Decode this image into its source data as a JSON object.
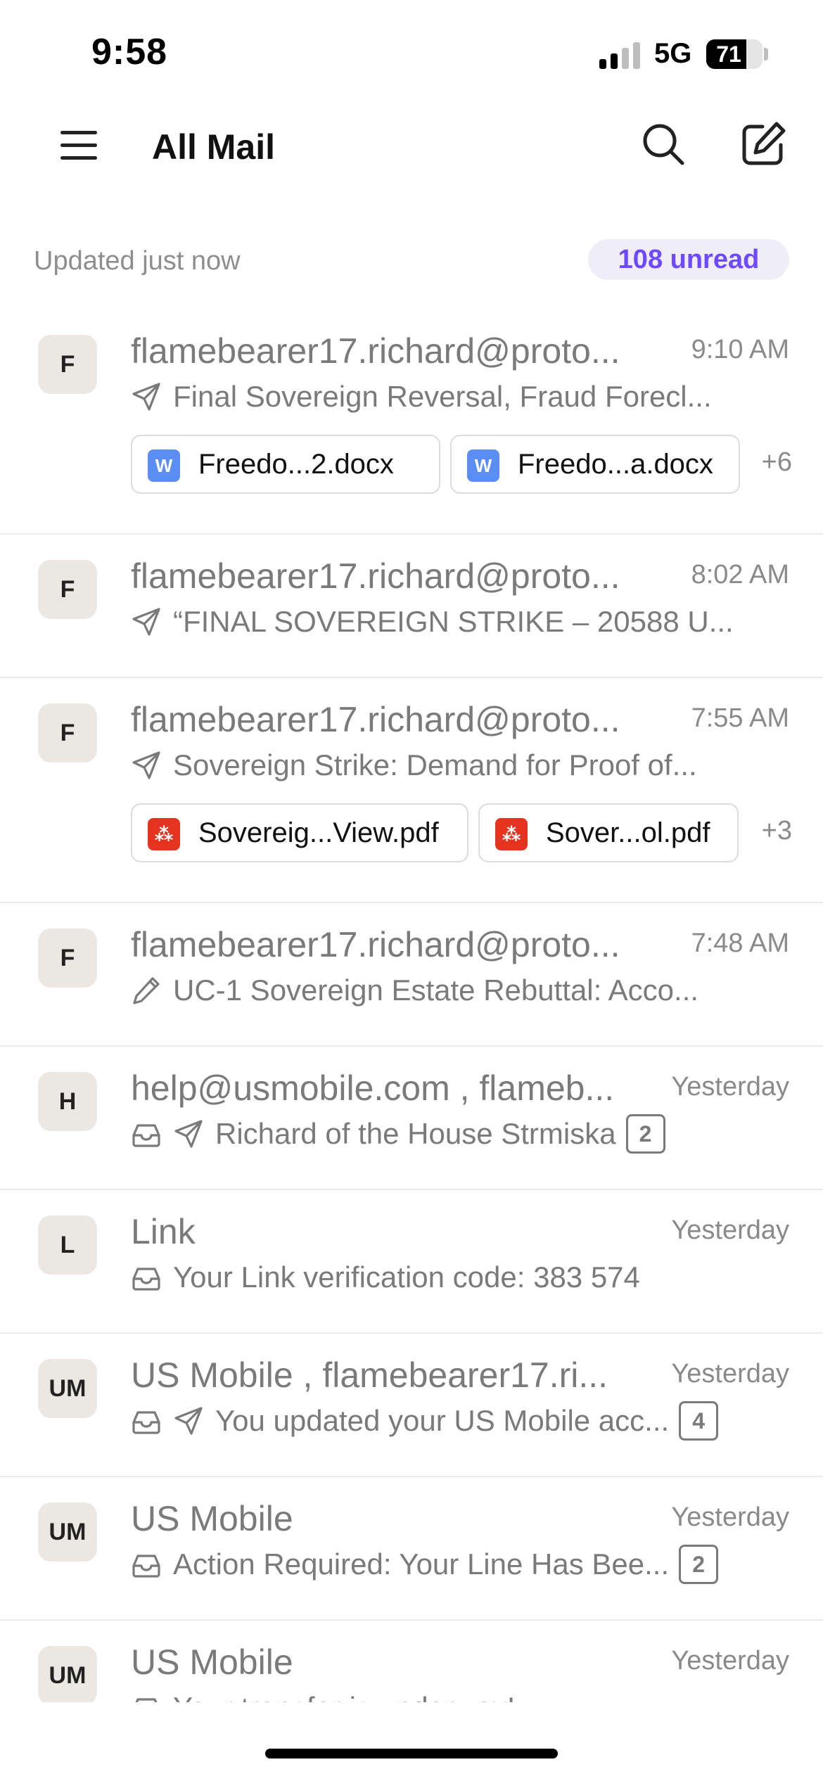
{
  "status_bar": {
    "time": "9:58",
    "network": "5G",
    "battery_level": "71",
    "battery_percent": 71
  },
  "header": {
    "title": "All Mail",
    "menu_icon": "hamburger-menu-icon",
    "search_icon": "search-icon",
    "compose_icon": "compose-icon"
  },
  "sync": {
    "updated_text": "Updated just now",
    "unread_text": "108 unread"
  },
  "colors": {
    "accent": "#6d4aff",
    "word_icon": "#5b8ef5",
    "pdf_icon": "#e63320"
  },
  "messages": [
    {
      "initials": "F",
      "sender": "flamebearer17.richard@proto...",
      "time": "9:10 AM",
      "icons": [
        "sent-icon"
      ],
      "subject": "Final Sovereign Reversal, Fraud Forecl...",
      "count": null,
      "attachments": [
        {
          "type": "word",
          "letter": "W",
          "name": "Freedo...2.docx"
        },
        {
          "type": "word",
          "letter": "W",
          "name": "Freedo...a.docx"
        }
      ],
      "more_attachments": "+6"
    },
    {
      "initials": "F",
      "sender": "flamebearer17.richard@proto...",
      "time": "8:02 AM",
      "icons": [
        "sent-icon"
      ],
      "subject": "“FINAL SOVEREIGN STRIKE – 20588 U...",
      "count": null,
      "attachments": [],
      "more_attachments": null
    },
    {
      "initials": "F",
      "sender": "flamebearer17.richard@proto...",
      "time": "7:55 AM",
      "icons": [
        "sent-icon"
      ],
      "subject": "Sovereign Strike: Demand for Proof of...",
      "count": null,
      "attachments": [
        {
          "type": "pdf",
          "letter": "⁂",
          "name": "Sovereig...View.pdf"
        },
        {
          "type": "pdf",
          "letter": "⁂",
          "name": "Sover...ol.pdf"
        }
      ],
      "more_attachments": "+3"
    },
    {
      "initials": "F",
      "sender": "flamebearer17.richard@proto...",
      "time": "7:48 AM",
      "icons": [
        "draft-pencil-icon"
      ],
      "subject": "UC-1 Sovereign Estate Rebuttal: Acco...",
      "count": null,
      "attachments": [],
      "more_attachments": null
    },
    {
      "initials": "H",
      "sender": "help@usmobile.com , flameb...",
      "time": "Yesterday",
      "icons": [
        "inbox-icon",
        "sent-icon"
      ],
      "subject": "Richard of the House Strmiska",
      "count": "2",
      "attachments": [],
      "more_attachments": null
    },
    {
      "initials": "L",
      "sender": "Link",
      "time": "Yesterday",
      "icons": [
        "inbox-icon"
      ],
      "subject": "Your Link verification code: 383 574",
      "count": null,
      "attachments": [],
      "more_attachments": null
    },
    {
      "initials": "UM",
      "sender": "US Mobile , flamebearer17.ri...",
      "time": "Yesterday",
      "icons": [
        "inbox-icon",
        "sent-icon"
      ],
      "subject": "You updated your US Mobile acc...",
      "count": "4",
      "attachments": [],
      "more_attachments": null
    },
    {
      "initials": "UM",
      "sender": "US Mobile",
      "time": "Yesterday",
      "icons": [
        "inbox-icon"
      ],
      "subject": "Action Required: Your Line Has Bee...",
      "count": "2",
      "attachments": [],
      "more_attachments": null
    },
    {
      "initials": "UM",
      "sender": "US Mobile",
      "time": "Yesterday",
      "icons": [
        "inbox-icon"
      ],
      "subject": "Your transfer is underway!",
      "count": null,
      "attachments": [],
      "more_attachments": null
    }
  ]
}
